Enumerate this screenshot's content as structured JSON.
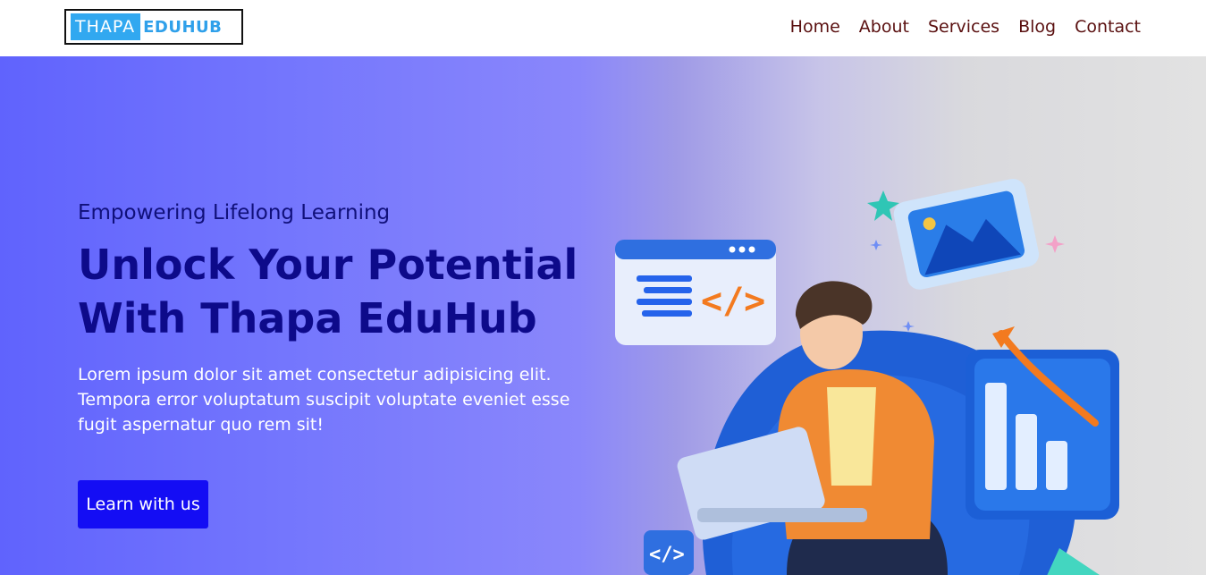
{
  "header": {
    "logo": {
      "box_text": "THAPA",
      "text": "EDUHUB"
    },
    "nav": [
      {
        "label": "Home"
      },
      {
        "label": "About"
      },
      {
        "label": "Services"
      },
      {
        "label": "Blog"
      },
      {
        "label": "Contact"
      }
    ]
  },
  "hero": {
    "subtitle": "Empowering Lifelong Learning",
    "headline": "Unlock Your Potential With Thapa EduHub",
    "lead": "Lorem ipsum dolor sit amet consectetur adipisicing elit. Tempora error voluptatum suscipit voluptate eveniet esse fugit aspernatur quo rem sit!",
    "cta_label": "Learn with us"
  },
  "colors": {
    "brand": "#31a8f0",
    "nav_text": "#5a1010",
    "headline": "#0d0a8a",
    "cta": "#140df4"
  }
}
